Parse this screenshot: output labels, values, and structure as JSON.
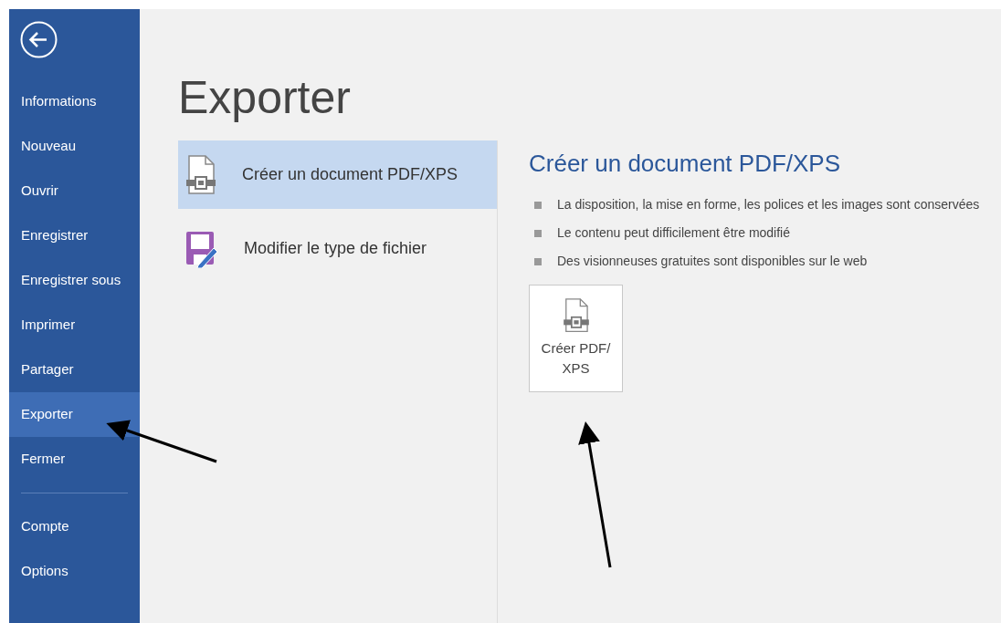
{
  "sidebar": {
    "items": [
      {
        "label": "Informations",
        "selected": false
      },
      {
        "label": "Nouveau",
        "selected": false
      },
      {
        "label": "Ouvrir",
        "selected": false
      },
      {
        "label": "Enregistrer",
        "selected": false
      },
      {
        "label": "Enregistrer sous",
        "selected": false
      },
      {
        "label": "Imprimer",
        "selected": false
      },
      {
        "label": "Partager",
        "selected": false
      },
      {
        "label": "Exporter",
        "selected": true
      },
      {
        "label": "Fermer",
        "selected": false
      }
    ],
    "bottom_items": [
      {
        "label": "Compte",
        "selected": false
      },
      {
        "label": "Options",
        "selected": false
      }
    ]
  },
  "page_title": "Exporter",
  "export_options": [
    {
      "label": "Créer un document PDF/XPS",
      "selected": true,
      "kind": "pdf"
    },
    {
      "label": "Modifier le type de fichier",
      "selected": false,
      "kind": "filetype"
    }
  ],
  "detail": {
    "heading": "Créer un document PDF/XPS",
    "bullets": [
      "La disposition, la mise en forme, les polices et les images sont conservées",
      "Le contenu peut difficilement être modifié",
      "Des visionneuses gratuites sont disponibles sur le web"
    ],
    "button": {
      "line_1": "Créer PDF/",
      "line_2": "XPS"
    }
  }
}
